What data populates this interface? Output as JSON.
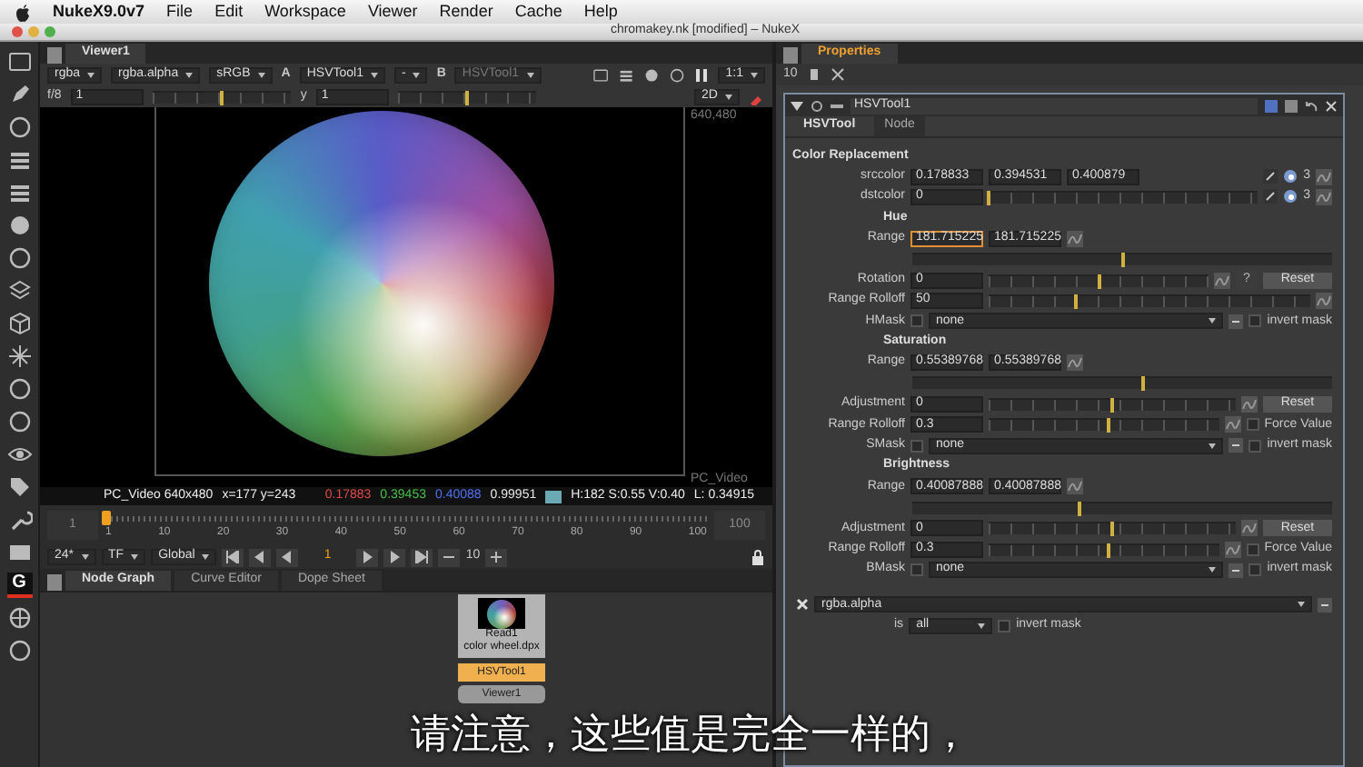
{
  "menubar": {
    "app": "NukeX9.0v7",
    "menus": [
      "File",
      "Edit",
      "Workspace",
      "Viewer",
      "Render",
      "Cache",
      "Help"
    ]
  },
  "window": {
    "title": "chromakey.nk [modified] – NukeX"
  },
  "left_toolbar": {
    "letter_button": "G"
  },
  "viewer": {
    "tab": "Viewer1",
    "toolbar": [
      {
        "kind": "dropdown",
        "text": "rgba",
        "disabled": false
      },
      {
        "kind": "dropdown",
        "text": "rgba.alpha",
        "disabled": false
      },
      {
        "kind": "dropdown",
        "text": "sRGB",
        "disabled": false
      },
      {
        "kind": "label",
        "text": "A",
        "disabled": false
      },
      {
        "kind": "dropdown",
        "text": "HSVTool1",
        "disabled": false
      },
      {
        "kind": "dropdown",
        "text": "-",
        "disabled": false
      },
      {
        "kind": "label",
        "text": "B",
        "disabled": false
      },
      {
        "kind": "dropdown",
        "text": "HSVTool1",
        "disabled": true
      }
    ],
    "zoom": "1:1",
    "gain": {
      "label": "f/8",
      "value": "1",
      "level": 0.5
    },
    "gamma": {
      "label": "y",
      "value": "1",
      "level": 0.5
    },
    "mode": "2D",
    "image": {
      "format_label": "PC_Video",
      "size_label": "640,480"
    },
    "info": {
      "format": "PC_Video 640x480",
      "position": "x=177 y=243",
      "samples": [
        {
          "text": "0.17883",
          "color": "#e04848"
        },
        {
          "text": "0.39453",
          "color": "#48c048"
        },
        {
          "text": "0.40088",
          "color": "#5070f0"
        },
        {
          "text": "0.99951",
          "color": "#e8e8e8"
        }
      ],
      "hsv": "H:182 S:0.55 V:0.40",
      "luma": "L: 0.34915"
    }
  },
  "timeline": {
    "start": "1",
    "end": "100",
    "ticks": [
      "1",
      "10",
      "20",
      "30",
      "40",
      "50",
      "60",
      "70",
      "80",
      "90",
      "100"
    ],
    "level": 0,
    "fps": "24*",
    "timecode": "TF",
    "range": "Global",
    "frame": "1",
    "increment": "10"
  },
  "panels": {
    "tabs": [
      {
        "label": "Node Graph",
        "selected": true
      },
      {
        "label": "Curve Editor",
        "selected": false
      },
      {
        "label": "Dope Sheet",
        "selected": false
      }
    ],
    "nodes": [
      {
        "kind": "read",
        "title": "Read1",
        "subtitle": "color wheel.dpx"
      },
      {
        "kind": "tool",
        "title": "HSVTool1"
      },
      {
        "kind": "viewer",
        "title": "Viewer1"
      }
    ]
  },
  "properties": {
    "tab": "Properties",
    "max_panels": "10",
    "node": "HSVTool1",
    "tabs": [
      {
        "label": "HSVTool",
        "selected": true
      },
      {
        "label": "Node",
        "selected": false
      }
    ],
    "rows": [
      {
        "kind": "section",
        "label": "Color Replacement"
      },
      {
        "kind": "color",
        "label": "srccolor",
        "values": [
          "0.178833",
          "0.394531",
          "0.400879"
        ],
        "channels": "3"
      },
      {
        "kind": "color",
        "label": "dstcolor",
        "values": [
          "0"
        ],
        "level": 0,
        "channels": "3"
      },
      {
        "kind": "subsection",
        "label": "Hue"
      },
      {
        "kind": "range",
        "label": "Range",
        "values": [
          "181.715225",
          "181.715225"
        ],
        "focused": true,
        "level": 0.5
      },
      {
        "kind": "slider",
        "label": "Rotation",
        "value": "0",
        "level": 0.5,
        "help": "?",
        "button": "Reset"
      },
      {
        "kind": "slider",
        "label": "Range Rolloff",
        "value": "50",
        "level": 0.27
      },
      {
        "kind": "mask",
        "label": "HMask",
        "checked": false,
        "value": "none",
        "invert": {
          "label": "invert mask",
          "checked": false
        }
      },
      {
        "kind": "subsection",
        "label": "Saturation"
      },
      {
        "kind": "range",
        "label": "Range",
        "values": [
          "0.55389768",
          "0.55389768"
        ],
        "focused": false,
        "level": 0.55
      },
      {
        "kind": "slider",
        "label": "Adjustment",
        "value": "0",
        "level": 0.5,
        "button": "Reset"
      },
      {
        "kind": "slider",
        "label": "Range Rolloff",
        "value": "0.3",
        "level": 0.52,
        "option": {
          "label": "Force Value",
          "checked": false
        }
      },
      {
        "kind": "mask",
        "label": "SMask",
        "checked": false,
        "value": "none",
        "invert": {
          "label": "invert mask",
          "checked": false
        }
      },
      {
        "kind": "subsection",
        "label": "Brightness"
      },
      {
        "kind": "range",
        "label": "Range",
        "values": [
          "0.40087888",
          "0.40087888"
        ],
        "focused": false,
        "level": 0.4
      },
      {
        "kind": "slider",
        "label": "Adjustment",
        "value": "0",
        "level": 0.5,
        "button": "Reset"
      },
      {
        "kind": "slider",
        "label": "Range Rolloff",
        "value": "0.3",
        "level": 0.52,
        "option": {
          "label": "Force Value",
          "checked": false
        }
      },
      {
        "kind": "mask",
        "label": "BMask",
        "checked": false,
        "value": "none",
        "invert": {
          "label": "invert mask",
          "checked": false
        }
      }
    ],
    "mask": {
      "channel": "rgba.alpha",
      "is_label": "is",
      "is_value": "all",
      "invert": {
        "label": "invert mask",
        "checked": false
      }
    }
  },
  "subtitle": "请注意，这些值是完全一样的，"
}
